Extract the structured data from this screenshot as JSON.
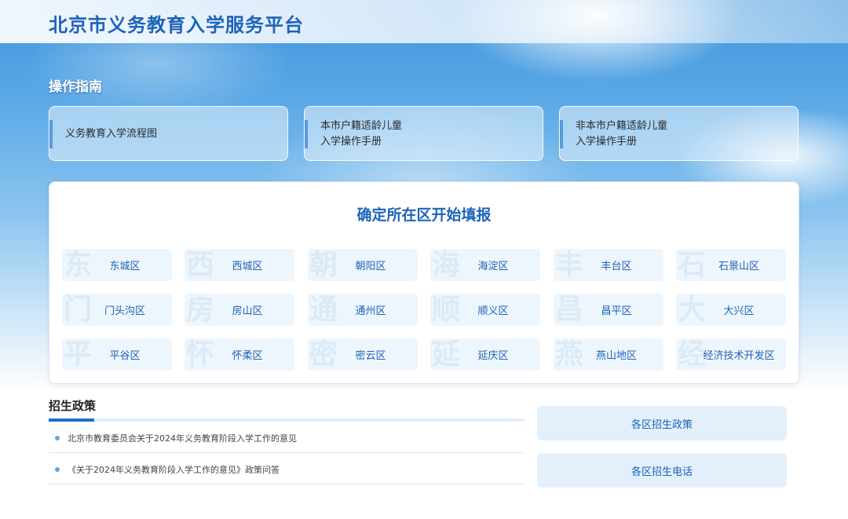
{
  "header": {
    "title": "北京市义务教育入学服务平台"
  },
  "guide": {
    "title": "操作指南",
    "cards": [
      {
        "line1": "义务教育入学流程图",
        "line2": ""
      },
      {
        "line1": "本市户籍适龄儿童",
        "line2": "入学操作手册"
      },
      {
        "line1": "非本市户籍适龄儿童",
        "line2": "入学操作手册"
      }
    ]
  },
  "districts": {
    "title": "确定所在区开始填报",
    "items": [
      {
        "wm": "东",
        "label": "东城区"
      },
      {
        "wm": "西",
        "label": "西城区"
      },
      {
        "wm": "朝",
        "label": "朝阳区"
      },
      {
        "wm": "海",
        "label": "海淀区"
      },
      {
        "wm": "丰",
        "label": "丰台区"
      },
      {
        "wm": "石",
        "label": "石景山区"
      },
      {
        "wm": "门",
        "label": "门头沟区"
      },
      {
        "wm": "房",
        "label": "房山区"
      },
      {
        "wm": "通",
        "label": "通州区"
      },
      {
        "wm": "顺",
        "label": "顺义区"
      },
      {
        "wm": "昌",
        "label": "昌平区"
      },
      {
        "wm": "大",
        "label": "大兴区"
      },
      {
        "wm": "平",
        "label": "平谷区"
      },
      {
        "wm": "怀",
        "label": "怀柔区"
      },
      {
        "wm": "密",
        "label": "密云区"
      },
      {
        "wm": "延",
        "label": "延庆区"
      },
      {
        "wm": "燕",
        "label": "燕山地区"
      },
      {
        "wm": "经",
        "label": "经济技术开发区"
      }
    ]
  },
  "policy": {
    "title": "招生政策",
    "items": [
      "北京市教育委员会关于2024年义务教育阶段入学工作的意见",
      "《关于2024年义务教育阶段入学工作的意见》政策问答"
    ]
  },
  "side_buttons": {
    "district_policy": "各区招生政策",
    "district_phone": "各区招生电话"
  },
  "colors": {
    "primary": "#1e63b8",
    "accent": "#1e6fcc",
    "district_bg": "#eef6fd"
  }
}
